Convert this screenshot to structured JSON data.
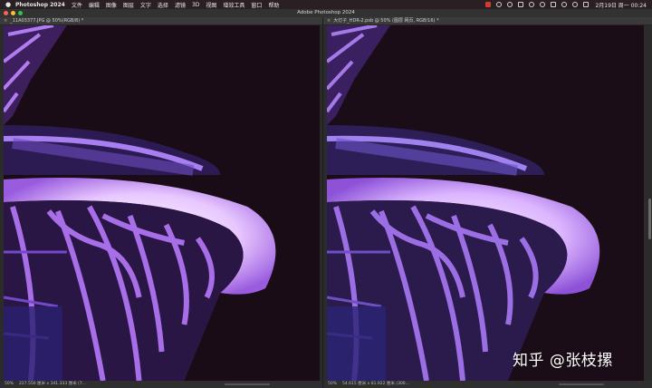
{
  "menubar": {
    "app_name": "Photoshop 2024",
    "items": [
      "文件",
      "编辑",
      "图像",
      "图层",
      "文字",
      "选择",
      "滤镜",
      "3D",
      "视图",
      "增效工具",
      "窗口",
      "帮助"
    ],
    "clock": "2月19日 周一  00:24"
  },
  "window": {
    "title": "Adobe Photoshop 2024"
  },
  "documents": [
    {
      "tab_label": "_11A03377.JPG @ 50%(RGB/8) *",
      "zoom": "50%",
      "status": "227.556 厘米 x 341.333 厘米 (7..."
    },
    {
      "tab_label": "大灯子_HDR-2.psb @ 50% (图层 网页, RGB/16) *",
      "zoom": "50%",
      "status": "54.615 厘米 x 81.922 厘米 (300..."
    }
  ],
  "watermark": "知乎 @张枝摞",
  "colors": {
    "background_sky": "#1a0c16",
    "structure_purple": "#8a4fd6",
    "glow": "#f3e6ff",
    "close_light": "#ff5f57",
    "minimize_light": "#febc2e",
    "zoom_light": "#28c840"
  }
}
